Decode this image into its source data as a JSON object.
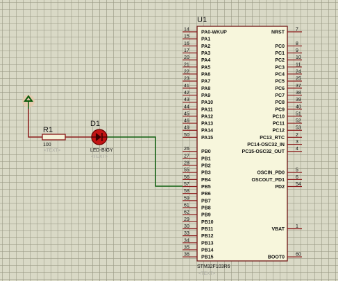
{
  "chip": {
    "ref": "U1",
    "part": "STM32F103R6",
    "text_placeholder": "<TEXT>",
    "left_pins": [
      {
        "num": "14",
        "name": "PA0-WKUP"
      },
      {
        "num": "15",
        "name": "PA1"
      },
      {
        "num": "16",
        "name": "PA2"
      },
      {
        "num": "17",
        "name": "PA3"
      },
      {
        "num": "20",
        "name": "PA4"
      },
      {
        "num": "21",
        "name": "PA5"
      },
      {
        "num": "22",
        "name": "PA6"
      },
      {
        "num": "23",
        "name": "PA7"
      },
      {
        "num": "41",
        "name": "PA8"
      },
      {
        "num": "42",
        "name": "PA9"
      },
      {
        "num": "43",
        "name": "PA10"
      },
      {
        "num": "44",
        "name": "PA11"
      },
      {
        "num": "45",
        "name": "PA12"
      },
      {
        "num": "46",
        "name": "PA13"
      },
      {
        "num": "49",
        "name": "PA14"
      },
      {
        "num": "50",
        "name": "PA15"
      },
      {
        "num": "",
        "name": ""
      },
      {
        "num": "26",
        "name": "PB0"
      },
      {
        "num": "27",
        "name": "PB1"
      },
      {
        "num": "28",
        "name": "PB2"
      },
      {
        "num": "55",
        "name": "PB3"
      },
      {
        "num": "56",
        "name": "PB4"
      },
      {
        "num": "57",
        "name": "PB5"
      },
      {
        "num": "58",
        "name": "PB6"
      },
      {
        "num": "59",
        "name": "PB7"
      },
      {
        "num": "61",
        "name": "PB8"
      },
      {
        "num": "62",
        "name": "PB9"
      },
      {
        "num": "29",
        "name": "PB10"
      },
      {
        "num": "30",
        "name": "PB11"
      },
      {
        "num": "33",
        "name": "PB12"
      },
      {
        "num": "34",
        "name": "PB13"
      },
      {
        "num": "35",
        "name": "PB14"
      },
      {
        "num": "36",
        "name": "PB15"
      }
    ],
    "right_pins": [
      {
        "num": "7",
        "name": "NRST"
      },
      {
        "num": "",
        "name": ""
      },
      {
        "num": "8",
        "name": "PC0"
      },
      {
        "num": "9",
        "name": "PC1"
      },
      {
        "num": "10",
        "name": "PC2"
      },
      {
        "num": "11",
        "name": "PC3"
      },
      {
        "num": "24",
        "name": "PC4"
      },
      {
        "num": "25",
        "name": "PC5"
      },
      {
        "num": "37",
        "name": "PC6"
      },
      {
        "num": "38",
        "name": "PC7"
      },
      {
        "num": "39",
        "name": "PC8"
      },
      {
        "num": "40",
        "name": "PC9"
      },
      {
        "num": "51",
        "name": "PC10"
      },
      {
        "num": "52",
        "name": "PC11"
      },
      {
        "num": "53",
        "name": "PC12"
      },
      {
        "num": "2",
        "name": "PC13_RTC"
      },
      {
        "num": "3",
        "name": "PC14-OSC32_IN"
      },
      {
        "num": "4",
        "name": "PC15-OSC32_OUT"
      },
      {
        "num": "",
        "name": ""
      },
      {
        "num": "",
        "name": ""
      },
      {
        "num": "5",
        "name": "OSCIN_PD0"
      },
      {
        "num": "6",
        "name": "OSCOUT_PD1"
      },
      {
        "num": "54",
        "name": "PD2"
      },
      {
        "num": "",
        "name": ""
      },
      {
        "num": "",
        "name": ""
      },
      {
        "num": "",
        "name": ""
      },
      {
        "num": "",
        "name": ""
      },
      {
        "num": "",
        "name": ""
      },
      {
        "num": "1",
        "name": "VBAT"
      },
      {
        "num": "",
        "name": ""
      },
      {
        "num": "",
        "name": ""
      },
      {
        "num": "",
        "name": ""
      },
      {
        "num": "60",
        "name": "BOOT0"
      }
    ]
  },
  "resistor": {
    "ref": "R1",
    "value": "100",
    "text_placeholder": "<TEXT>"
  },
  "led": {
    "ref": "D1",
    "value": "LED-BIGY",
    "text_placeholder": "<TEXT>"
  },
  "colors": {
    "grid_bg": "#d9d9c6",
    "chip_body": "#f7f6dc",
    "pin_line": "#8b1a1a",
    "wire": "#0d5e0d",
    "led_red": "#c21414",
    "power_green": "#0a5a0a"
  },
  "icons": {
    "power": "power-terminal-icon",
    "led": "led-icon",
    "resistor": "resistor-icon"
  }
}
